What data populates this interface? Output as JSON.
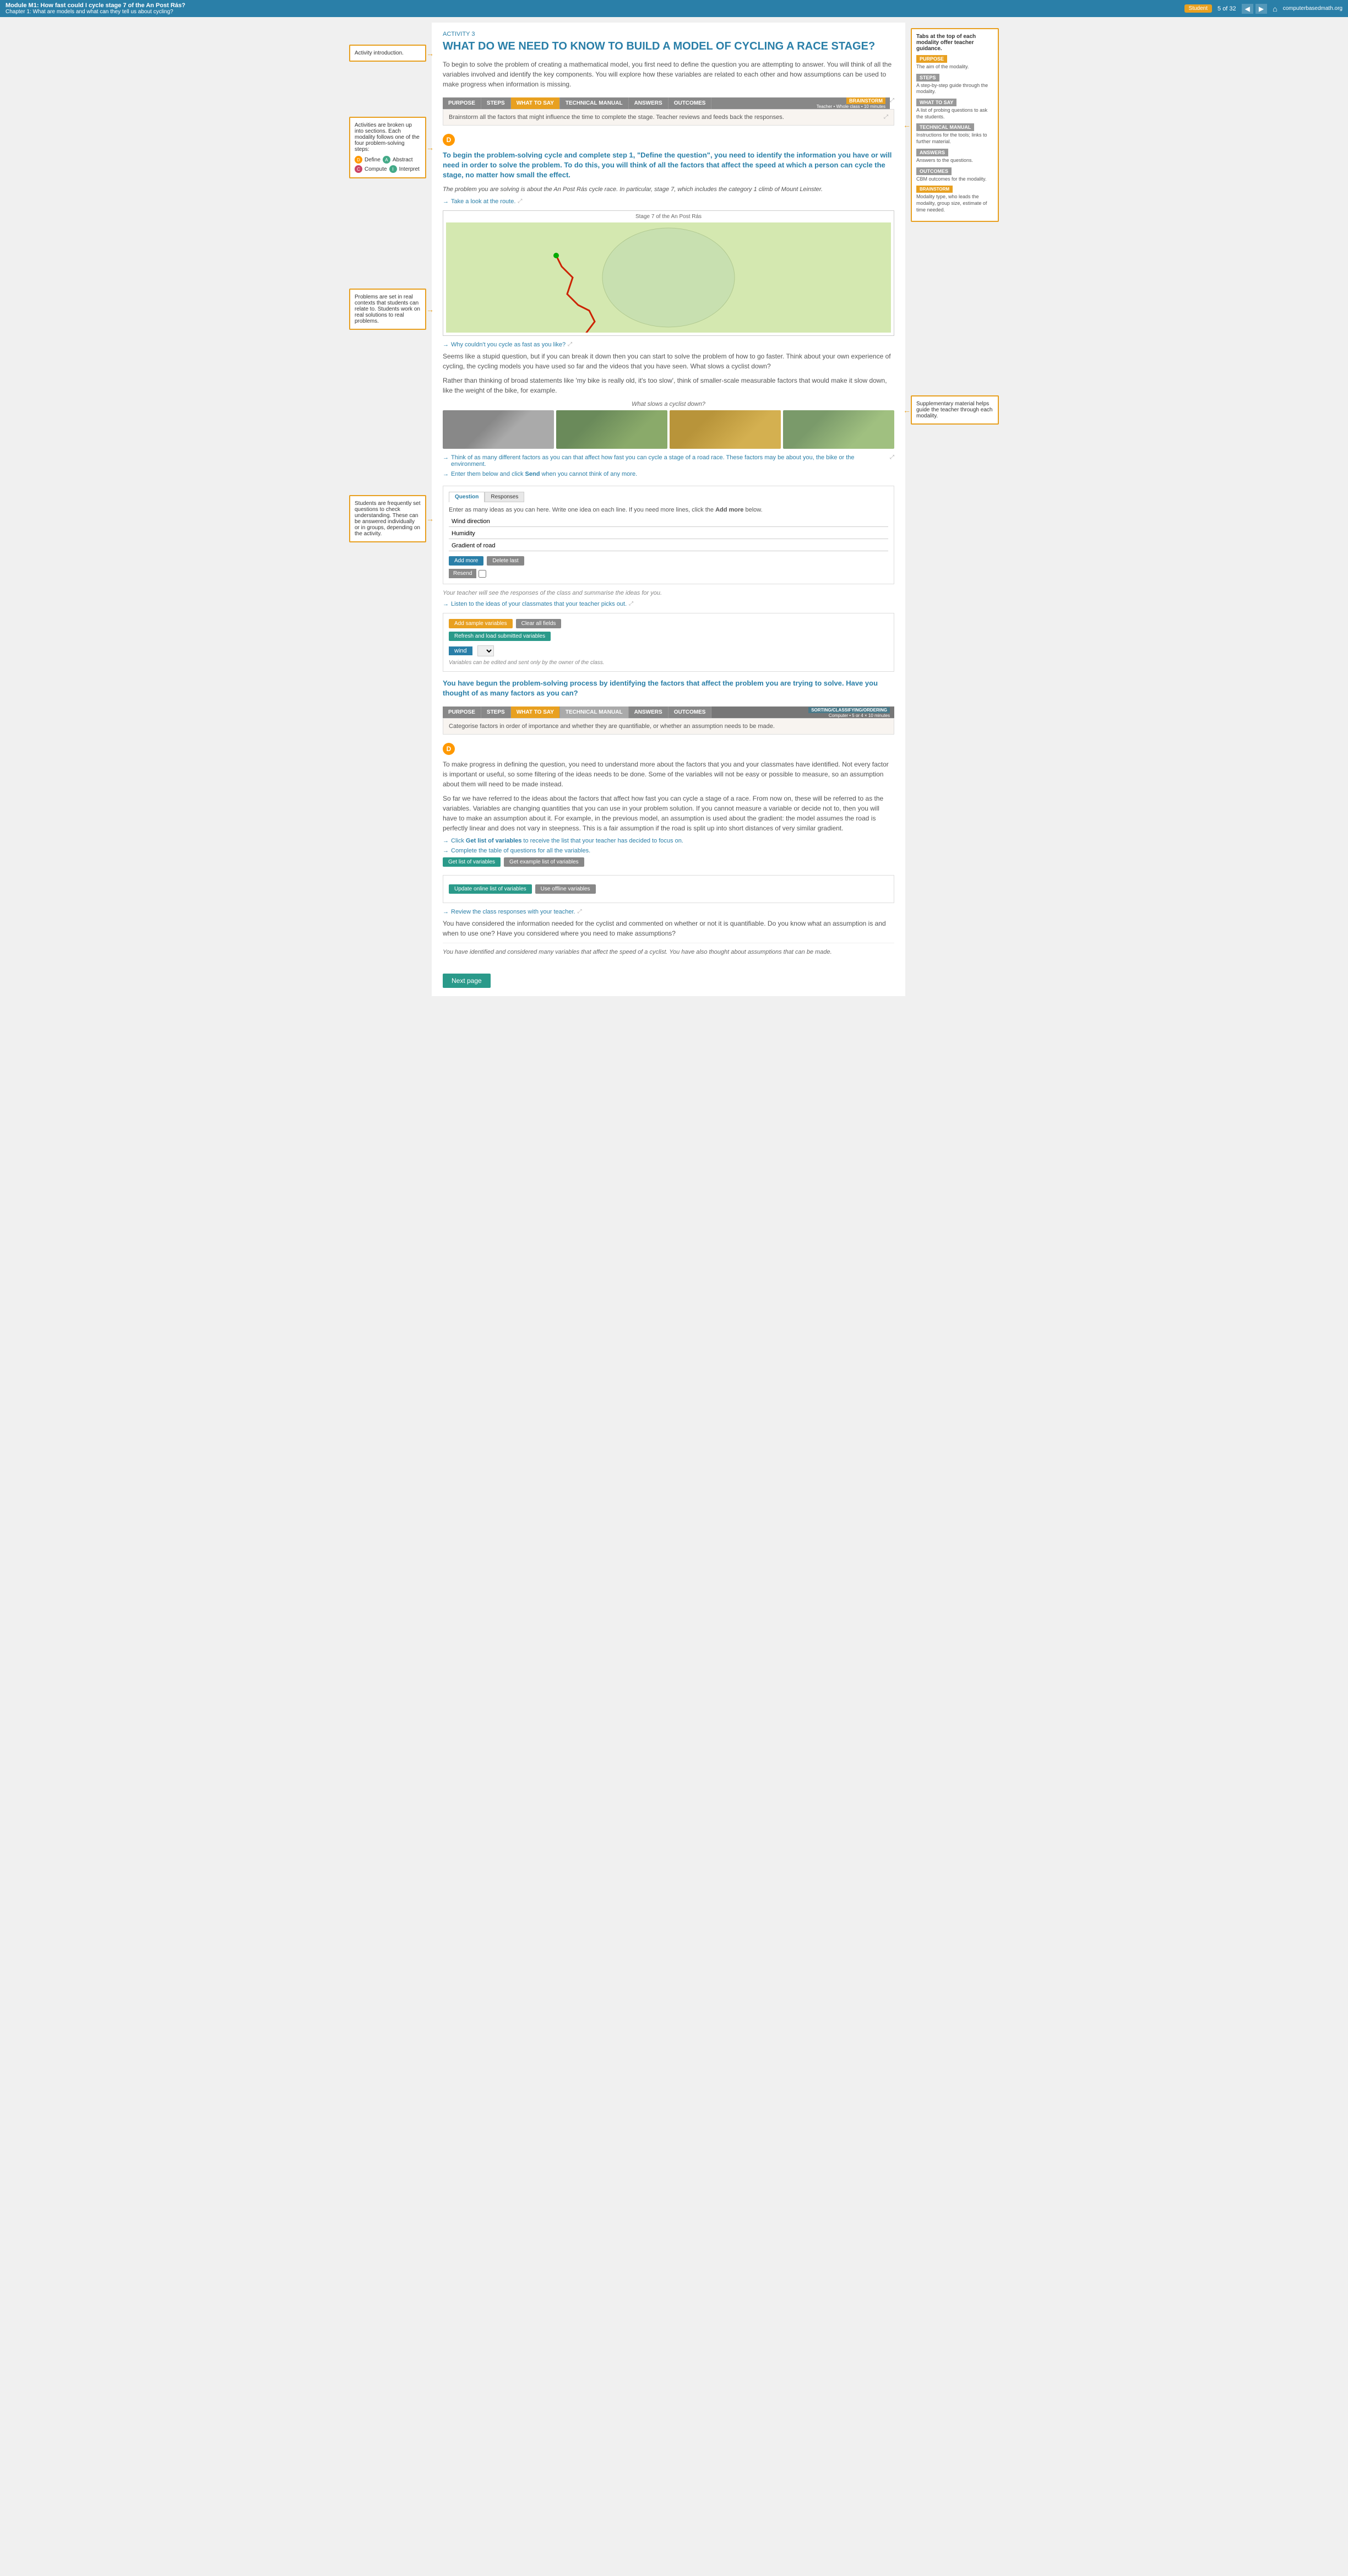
{
  "topnav": {
    "module": "Module M1: How fast could I cycle stage 7 of the An Post Rás?",
    "chapter": "Chapter 1: What are models and what can they tell us about cycling?",
    "student_btn": "Student",
    "page_counter": "5 of 32",
    "brand": "computerbasedmath.org"
  },
  "activity": {
    "label": "ACTIVITY 3",
    "title": "WHAT DO WE NEED TO KNOW TO BUILD A MODEL OF CYCLING A RACE STAGE?",
    "intro": "To begin to solve the problem of creating a mathematical model, you first need to define the question you are attempting to answer. You will think of all the variables involved and identify the key components. You will explore how these variables are related to each other and how assumptions can be used to make progress when information is missing."
  },
  "tabs1": {
    "items": [
      "PURPOSE",
      "STEPS",
      "WHAT TO SAY",
      "TECHNICAL MANUAL",
      "ANSWERS",
      "OUTCOMES"
    ],
    "active": "WHAT TO SAY",
    "badge": "BRAINSTORM",
    "badge_detail": "Teacher • Whole class • 10 minutes",
    "content": "Brainstorm all the factors that might influence the time to complete the stage. Teacher reviews and feeds back the responses."
  },
  "section1": {
    "intro": "To begin the problem-solving cycle and complete step 1, \"Define the question\", you need to identify the information you have or will need in order to solve the problem. To do this, you will think of all the factors that affect the speed at which a person can cycle the stage, no matter how small the effect.",
    "italic_text": "The problem you are solving is about the An Post Rás cycle race. In particular, stage 7, which includes the category 1 climb of Mount Leinster.",
    "arrow1": "Take a look at the route.",
    "map_label": "Stage 7 of the An Post Rás",
    "question1": "Why couldn't you cycle as fast as you like?",
    "question1_text": "Seems like a stupid question, but if you can break it down then you can start to solve the problem of how to go faster. Think about your own experience of cycling, the cycling models you have used so far and the videos that you have seen. What slows a cyclist down?",
    "question1_sub": "Rather than thinking of broad statements like 'my bike is really old, it's too slow', think of smaller-scale measurable factors that would make it slow down, like the weight of the bike, for example.",
    "images_label": "What slows a cyclist down?",
    "arrow2": "Think of as many different factors as you can that affect how fast you can cycle a stage of a road race. These factors may be about you, the bike or the environment.",
    "arrow3": "Enter them below and click",
    "arrow3_bold": "Send",
    "arrow3_end": "when you cannot think of any more."
  },
  "input_tabs": {
    "question": "Question",
    "responses": "Responses"
  },
  "input_section": {
    "instruction": "Enter as many ideas as you can here. Write one idea on each line. If you need more lines, click the",
    "add_more_inline": "Add more",
    "instruction_end": "below.",
    "fields": [
      "Wind direction",
      "Humidity",
      "Gradient of road"
    ],
    "add_more": "Add more",
    "delete_last": "Delete last",
    "resend": "Resend"
  },
  "teacher_note": "Your teacher will see the responses of the class and summarise the ideas for you.",
  "arrow_listen": "Listen to the ideas of your classmates that your teacher picks out.",
  "variables_section": {
    "add_sample": "Add sample variables",
    "clear_all": "Clear all fields",
    "refresh": "Refresh and load submitted variables",
    "var_name": "wind",
    "var_note": "Variables can be edited and sent only by the owner of the class."
  },
  "highlight1": "You have begun the problem-solving process by identifying the factors that affect the problem you are trying to solve. Have you thought of as many factors as you can?",
  "tabs2": {
    "items": [
      "PURPOSE",
      "STEPS",
      "WHAT TO SAY",
      "TECHNICAL MANUAL",
      "ANSWERS",
      "OUTCOMES"
    ],
    "active": "WHAT TO SAY",
    "badge": "SORTING/CLASSIFYING/ORDERING",
    "badge_detail": "Computer • 5 or 4 × 10 minutes",
    "content": "Categorise factors in order of importance and whether they are quantifiable, or whether an assumption needs to be made."
  },
  "section2": {
    "intro": "To make progress in defining the question, you need to understand more about the factors that you and your classmates have identified. Not every factor is important or useful, so some filtering of the ideas needs to be done. Some of the variables will not be easy or possible to measure, so an assumption about them will need to be made instead.",
    "para2": "So far we have referred to the ideas about the factors that affect how fast you can cycle a stage of a race. From now on, these will be referred to as the variables. Variables are changing quantities that you can use in your problem solution. If you cannot measure a variable or decide not to, then you will have to make an assumption about it. For example, in the previous model, an assumption is used about the gradient: the model assumes the road is perfectly linear and does not vary in steepness. This is a fair assumption if the road is split up into short distances of very similar gradient.",
    "arrow1": "Click",
    "get_list_bold": "Get list of variables",
    "arrow1_end": "to receive the list that your teacher has decided to focus on.",
    "arrow2": "Complete the table of questions for all the variables.",
    "get_list_btn": "Get list of variables",
    "get_example_btn": "Get example list of variables"
  },
  "online_section": {
    "update_btn": "Update online list of variables",
    "offline_btn": "Use offline variables"
  },
  "section3": {
    "arrow1": "Review the class responses with your teacher.",
    "text1": "You have considered the information needed for the cyclist and commented on whether or not it is quantifiable. Do you know what an assumption is and when to use one? Have you considered where you need to make assumptions?",
    "text2": "You have identified and considered many variables that affect the speed of a cyclist. You have also thought about assumptions that can be made."
  },
  "next_page": "Next page",
  "left_annotations": {
    "intro": "Activity introduction.",
    "sections": "Activities are broken up into sections. Each modality follows one of the four problem-solving steps:",
    "steps": [
      {
        "label": "Define",
        "color": "#f90"
      },
      {
        "label": "Abstract",
        "color": "#4a8"
      },
      {
        "label": "Compute",
        "color": "#c46"
      },
      {
        "label": "Interpret",
        "color": "#4a8"
      }
    ],
    "real_context": "Problems are set in real contexts that students can relate to. Students work on real solutions to real problems.",
    "questions": "Students are frequently set questions to check understanding. These can be answered individually or in groups, depending on the activity."
  },
  "right_annotations": {
    "tabs_title": "Tabs at the top of each modality offer teacher guidance.",
    "tabs_detail": [
      {
        "label": "PURPOSE",
        "desc": "The aim of the modality."
      },
      {
        "label": "STEPS",
        "desc": "A step-by-step guide through the modality."
      },
      {
        "label": "WHAT TO SAY",
        "desc": "A list of probing questions to ask the students."
      },
      {
        "label": "TECHNICAL MANUAL",
        "desc": "Instructions for the tools; links to further material."
      },
      {
        "label": "ANSWERS",
        "desc": "Answers to the questions."
      },
      {
        "label": "OUTCOMES",
        "desc": "CBM outcomes for the modality."
      },
      {
        "label": "BRAINSTORM",
        "desc": "Modality type, who leads the modality, group size, estimate of time needed."
      }
    ],
    "supplementary": "Supplementary material helps guide the teacher through each modality."
  }
}
